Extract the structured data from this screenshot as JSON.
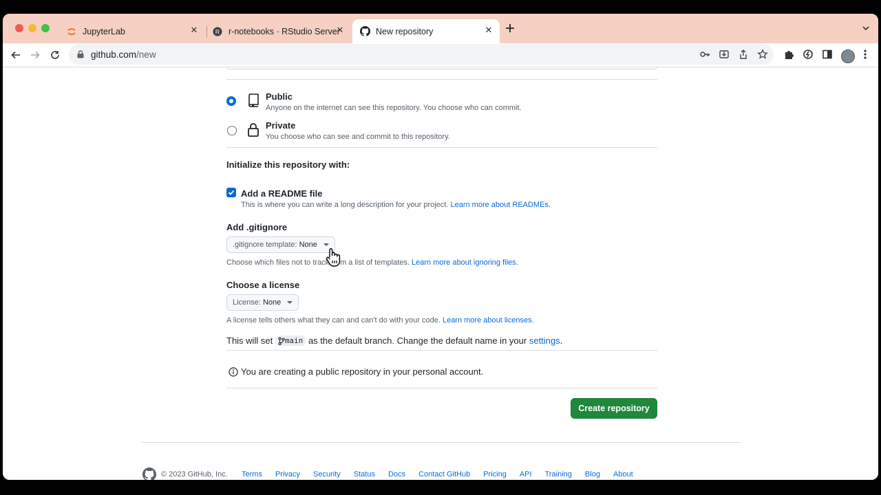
{
  "browser": {
    "tabs": [
      {
        "title": "JupyterLab",
        "icon": "jupyter-icon",
        "active": false
      },
      {
        "title": "r-notebooks · RStudio Server",
        "icon": "rstudio-icon",
        "active": false
      },
      {
        "title": "New repository",
        "icon": "github-icon",
        "active": true
      }
    ],
    "url_host": "github.com",
    "url_path": "/new"
  },
  "visibility": {
    "public_label": "Public",
    "public_desc": "Anyone on the internet can see this repository. You choose who can commit.",
    "private_label": "Private",
    "private_desc": "You choose who can see and commit to this repository.",
    "selected": "public"
  },
  "initialize": {
    "heading": "Initialize this repository with:",
    "readme_label": "Add a README file",
    "readme_checked": true,
    "readme_desc": "This is where you can write a long description for your project.",
    "readme_link": "Learn more about READMEs."
  },
  "gitignore": {
    "heading": "Add .gitignore",
    "select_label": ".gitignore template:",
    "select_value": "None",
    "desc": "Choose which files not to track from a list of templates.",
    "link": "Learn more about ignoring files."
  },
  "license": {
    "heading": "Choose a license",
    "select_label": "License:",
    "select_value": "None",
    "desc": "A license tells others what they can and can't do with your code.",
    "link": "Learn more about licenses."
  },
  "branch": {
    "prefix": "This will set",
    "name": "main",
    "suffix": "as the default branch. Change the default name in your",
    "link": "settings",
    "end": "."
  },
  "notice": "You are creating a public repository in your personal account.",
  "create_button": "Create repository",
  "footer": {
    "copyright": "© 2023 GitHub, Inc.",
    "links": [
      "Terms",
      "Privacy",
      "Security",
      "Status",
      "Docs",
      "Contact GitHub",
      "Pricing",
      "API",
      "Training",
      "Blog",
      "About"
    ]
  },
  "colors": {
    "primary": "#1f883d",
    "link": "#0969da",
    "tab_bar": "#f6d0c3"
  }
}
